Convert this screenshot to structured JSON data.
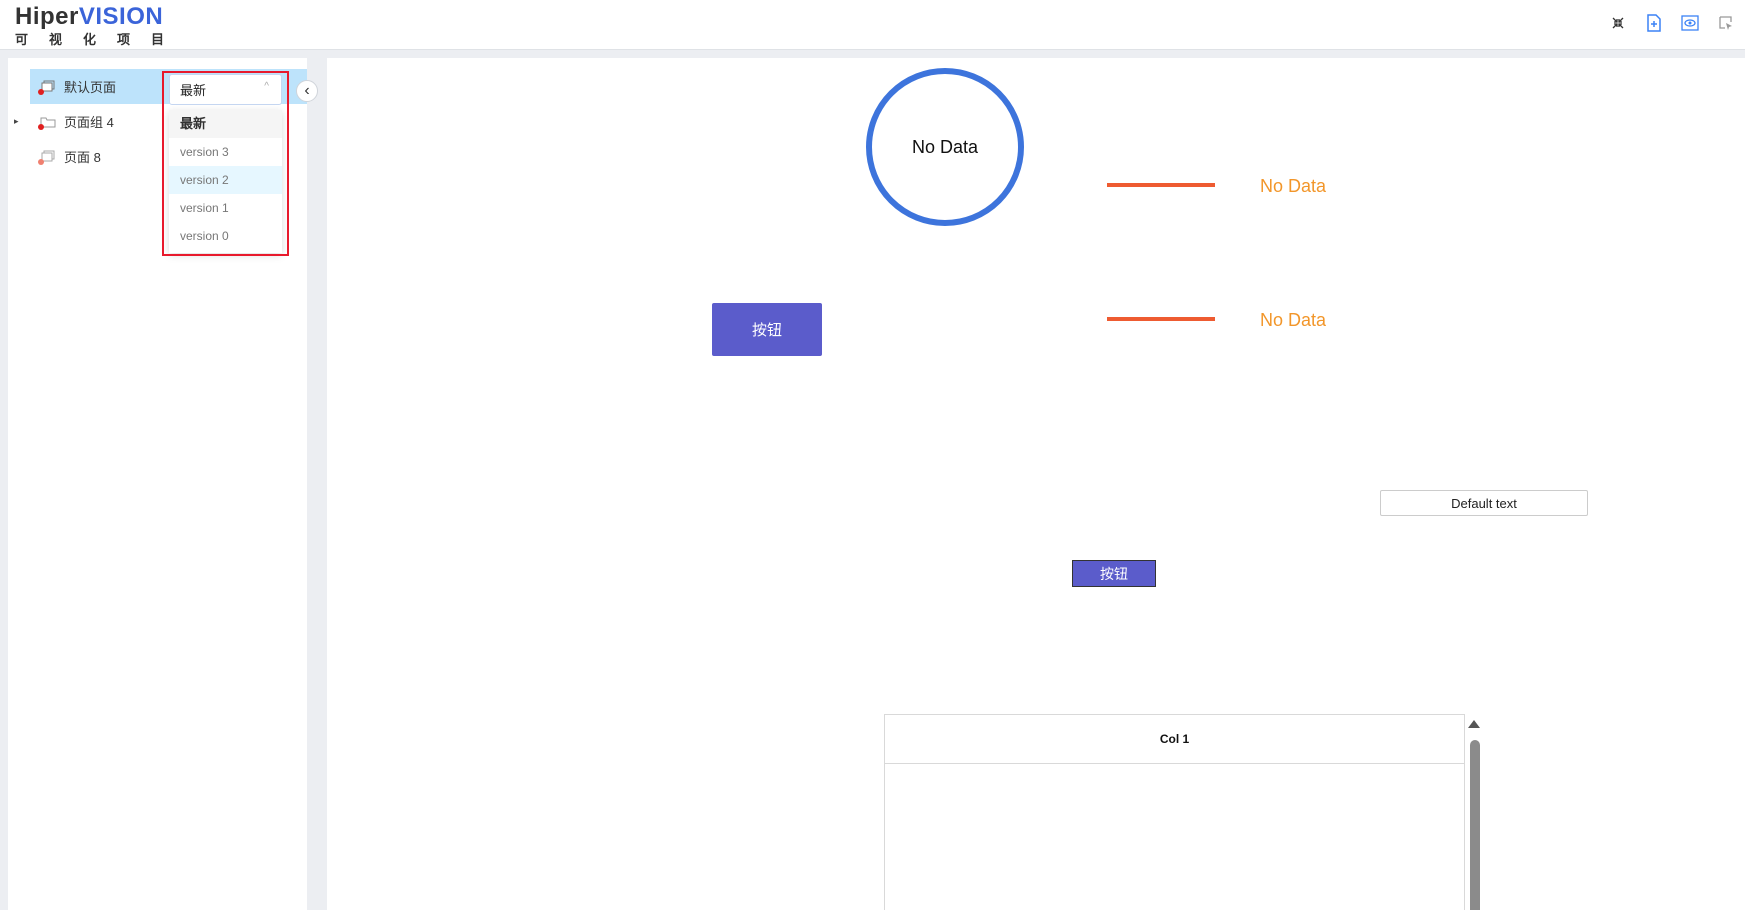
{
  "header": {
    "logo_part1": "Hiper",
    "logo_part2": "VISION",
    "logo_sub": "可视化项目",
    "toolbar_icons": [
      "collapse-icon",
      "document-icon",
      "preview-icon",
      "select-icon"
    ]
  },
  "sidebar": {
    "items": [
      {
        "label": "默认页面",
        "selected": true
      },
      {
        "label": "页面组 4",
        "has_children": true
      },
      {
        "label": "页面 8"
      }
    ],
    "tree_arrow": "▸",
    "collapse_glyph": "‹"
  },
  "version_select": {
    "value": "最新",
    "chevron": "^",
    "options": [
      "最新",
      "version 3",
      "version 2",
      "version 1",
      "version 0"
    ],
    "hover_index": 2
  },
  "canvas": {
    "ring_label": "No Data",
    "orange_label_1": "No Data",
    "orange_label_2": "No Data",
    "button_big": "按钮",
    "button_small": "按钮",
    "input_value": "Default text",
    "table": {
      "columns": [
        "Col 1"
      ]
    }
  },
  "colors": {
    "accent_blue": "#3d74dc",
    "button_purple": "#5b5ccb",
    "line_red": "#ee5b31",
    "label_orange": "#f2962a",
    "selected_row": "#bde3fb",
    "highlight_red": "#e8192c"
  }
}
